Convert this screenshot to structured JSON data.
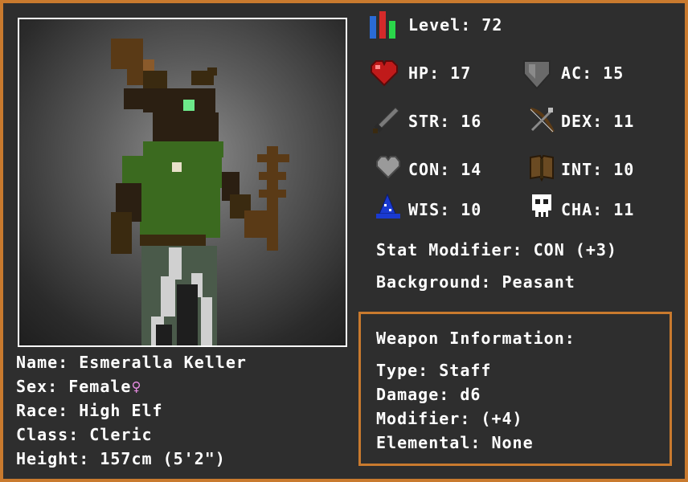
{
  "colors": {
    "border": "#c97a2e",
    "panel": "#2e2e2e",
    "text": "#ffffff",
    "female": "#e58be0"
  },
  "level": {
    "label": "Level:",
    "value": "72",
    "icon": "level-bars-icon"
  },
  "stats": {
    "hp": {
      "label": "HP:",
      "value": "17",
      "icon": "heart-icon"
    },
    "ac": {
      "label": "AC:",
      "value": "15",
      "icon": "shield-icon"
    },
    "str": {
      "label": "STR:",
      "value": "16",
      "icon": "sword-icon"
    },
    "dex": {
      "label": "DEX:",
      "value": "11",
      "icon": "bow-icon"
    },
    "con": {
      "label": "CON:",
      "value": "14",
      "icon": "grey-heart-icon"
    },
    "int": {
      "label": "INT:",
      "value": "10",
      "icon": "book-icon"
    },
    "wis": {
      "label": "WIS:",
      "value": "10",
      "icon": "wizard-hat-icon"
    },
    "cha": {
      "label": "CHA:",
      "value": "11",
      "icon": "skull-icon"
    }
  },
  "stat_modifier": {
    "label": "Stat Modifier:",
    "value": "CON (+3)"
  },
  "background": {
    "label": "Background:",
    "value": "Peasant"
  },
  "character": {
    "name": {
      "label": "Name:",
      "value": "Esmeralla Keller"
    },
    "sex": {
      "label": "Sex:",
      "value": "Female",
      "glyph": "♀"
    },
    "race": {
      "label": "Race:",
      "value": "High Elf"
    },
    "class": {
      "label": "Class:",
      "value": "Cleric"
    },
    "height": {
      "label": "Height:",
      "value": "157cm (5'2\")"
    }
  },
  "weapon": {
    "title": "Weapon Information:",
    "type": {
      "label": "Type:",
      "value": "Staff"
    },
    "damage": {
      "label": "Damage:",
      "value": "d6"
    },
    "modifier": {
      "label": "Modifier:",
      "value": "(+4)"
    },
    "elemental": {
      "label": "Elemental:",
      "value": "None"
    }
  }
}
